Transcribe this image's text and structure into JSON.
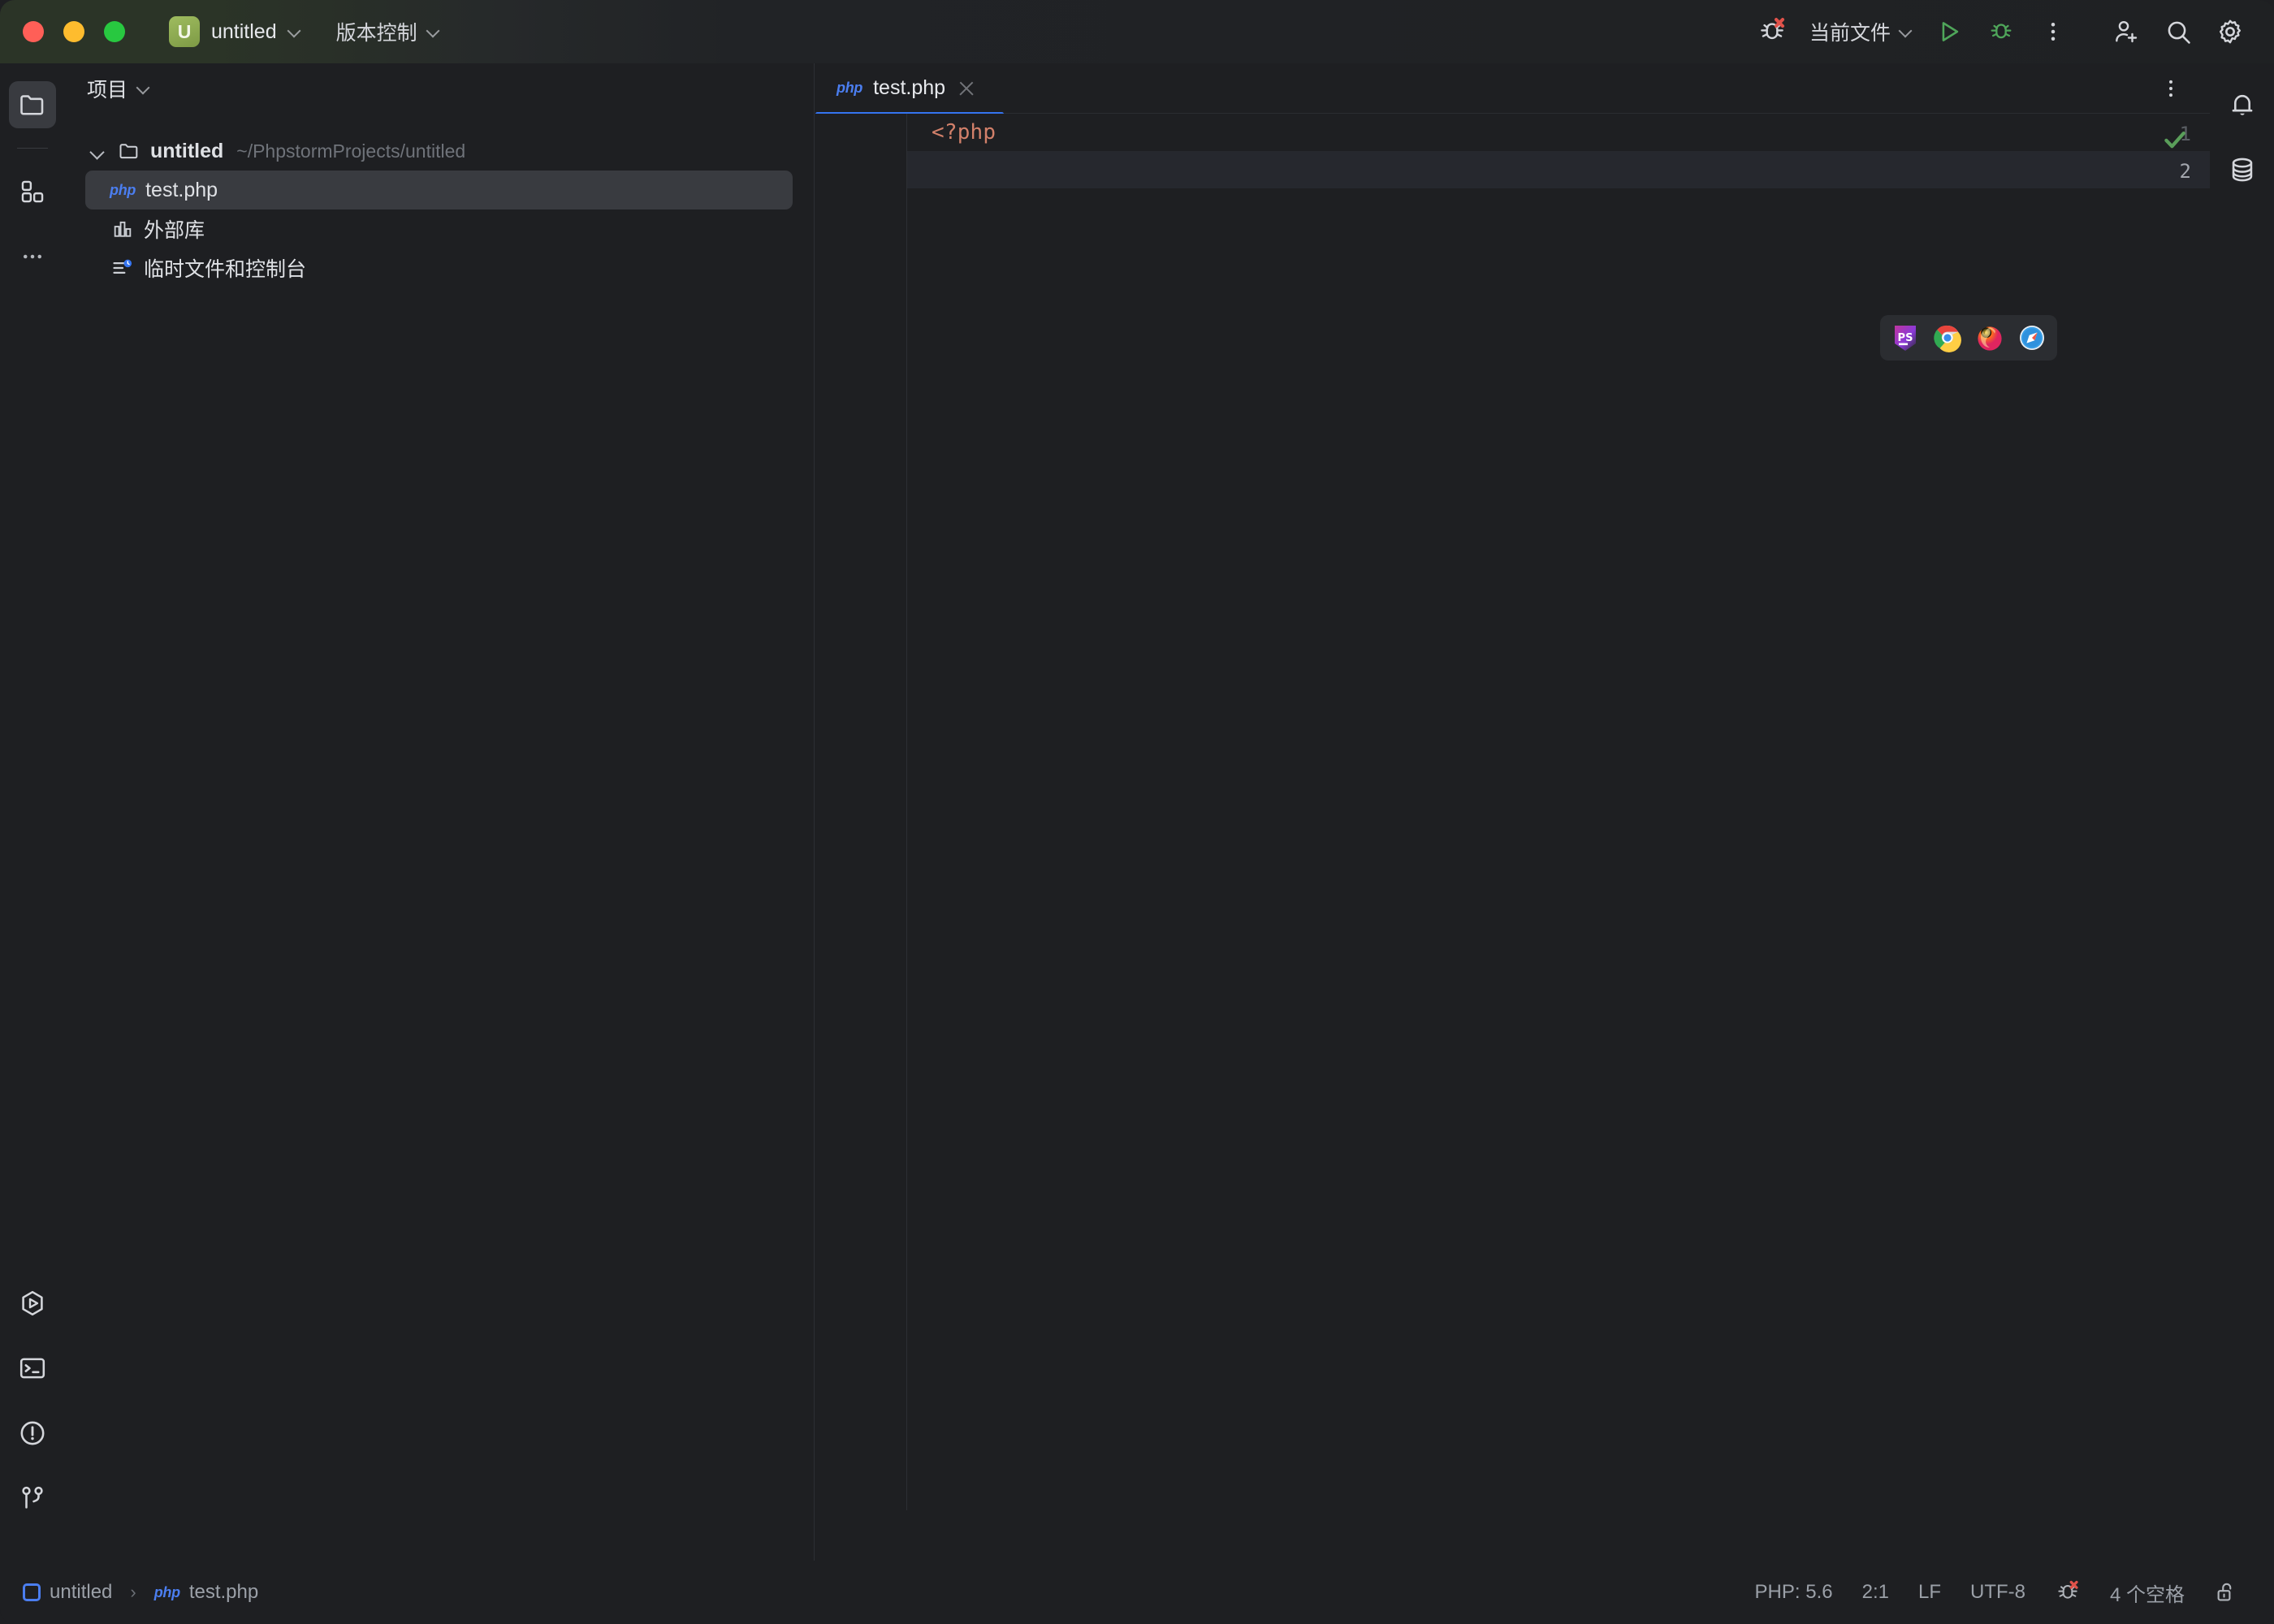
{
  "window": {
    "traffic_lights": [
      "close",
      "minimize",
      "zoom"
    ],
    "colors": {
      "accent_blue": "#3574f0",
      "badge_green": "#8fae52",
      "ok_green": "#5a9e5a",
      "php_blue": "#4b7ef0"
    }
  },
  "titlebar": {
    "project_badge": "U",
    "project_name": "untitled",
    "vcs_label": "版本控制",
    "debug_attach_icon": "bug-error-icon",
    "run_config": "当前文件",
    "run_icon": "run-triangle-icon",
    "debug_icon": "debug-bug-icon",
    "more_icon": "more-vertical-icon",
    "account_icon": "account-add-icon",
    "search_icon": "search-icon",
    "settings_icon": "gear-icon"
  },
  "left_rail": {
    "top": [
      {
        "name": "project-tool-window",
        "icon": "folder-icon",
        "active": true
      },
      {
        "name": "structure-tool-window",
        "icon": "blocks-icon",
        "active": false
      },
      {
        "name": "more-tool-windows",
        "icon": "more-horizontal-icon",
        "active": false
      }
    ],
    "bottom": [
      {
        "name": "run-tool-window",
        "icon": "run-hexagon-icon"
      },
      {
        "name": "terminal-tool-window",
        "icon": "terminal-icon"
      },
      {
        "name": "problems-tool-window",
        "icon": "warning-circle-icon"
      },
      {
        "name": "version-control-tool-window",
        "icon": "git-branch-icon"
      }
    ]
  },
  "right_rail": [
    {
      "name": "notifications",
      "icon": "bell-icon"
    },
    {
      "name": "database",
      "icon": "database-icon"
    }
  ],
  "project_panel": {
    "title": "项目",
    "tree": [
      {
        "label": "untitled",
        "path": "~/PhpstormProjects/untitled",
        "icon": "folder-icon",
        "expanded": true,
        "depth": 0,
        "selected": false,
        "bold": true
      },
      {
        "label": "test.php",
        "path": "",
        "icon": "php-file-icon",
        "expanded": null,
        "depth": 1,
        "selected": true,
        "bold": false
      },
      {
        "label": "外部库",
        "path": "",
        "icon": "external-libraries-icon",
        "expanded": null,
        "depth": 0,
        "selected": false,
        "bold": false
      },
      {
        "label": "临时文件和控制台",
        "path": "",
        "icon": "scratches-icon",
        "expanded": null,
        "depth": 0,
        "selected": false,
        "bold": false
      }
    ]
  },
  "editor": {
    "tab": {
      "label": "test.php",
      "icon": "php-file-icon",
      "close_icon": "close-icon",
      "active": true
    },
    "tab_kebab_icon": "more-vertical-icon",
    "inspection_status_icon": "check-icon",
    "lines": [
      {
        "number": "1",
        "text": "<?php",
        "caret": false
      },
      {
        "number": "2",
        "text": "",
        "caret": true
      }
    ],
    "browser_popup": [
      {
        "name": "phpstorm-builtin-preview",
        "icon": "phpstorm-icon",
        "label": "PS"
      },
      {
        "name": "chrome-preview",
        "icon": "chrome-icon",
        "label": ""
      },
      {
        "name": "firefox-preview",
        "icon": "firefox-icon",
        "label": ""
      },
      {
        "name": "safari-preview",
        "icon": "safari-icon",
        "label": ""
      }
    ]
  },
  "status_bar": {
    "breadcrumb": [
      {
        "label": "untitled",
        "icon": "module-icon"
      },
      {
        "label": "test.php",
        "icon": "php-file-icon"
      }
    ],
    "separator": "›",
    "right_items": [
      {
        "name": "php-version",
        "label": "PHP: 5.6"
      },
      {
        "name": "caret-position",
        "label": "2:1"
      },
      {
        "name": "line-separator",
        "label": "LF"
      },
      {
        "name": "file-encoding",
        "label": "UTF-8"
      },
      {
        "name": "debug-status",
        "label": "",
        "icon": "bug-error-icon"
      },
      {
        "name": "indent-size",
        "label": "4 个空格"
      },
      {
        "name": "read-only-toggle",
        "label": "",
        "icon": "unlock-icon"
      }
    ]
  }
}
